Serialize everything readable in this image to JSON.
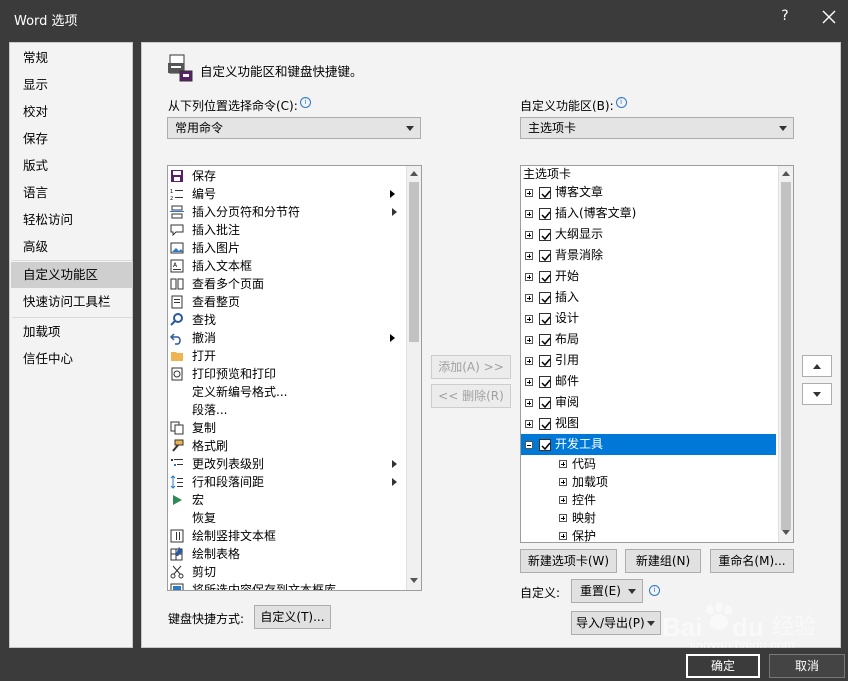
{
  "window": {
    "title": "Word 选项",
    "help": "?"
  },
  "nav": {
    "items": [
      "常规",
      "显示",
      "校对",
      "保存",
      "版式",
      "语言",
      "轻松访问",
      "高级",
      "自定义功能区",
      "快速访问工具栏",
      "加载项",
      "信任中心"
    ],
    "selected": "自定义功能区"
  },
  "main": {
    "heading": "自定义功能区和键盘快捷键。",
    "choose_label": "从下列位置选择命令(C):",
    "choose_value": "常用命令",
    "customize_label": "自定义功能区(B):",
    "customize_value": "主选项卡",
    "commands": [
      "保存",
      "编号",
      "插入分页符和分节符",
      "插入批注",
      "插入图片",
      "插入文本框",
      "查看多个页面",
      "查看整页",
      "查找",
      "撤消",
      "打开",
      "打印预览和打印",
      "定义新编号格式...",
      "段落...",
      "复制",
      "格式刷",
      "更改列表级别",
      "行和段落间距",
      "宏",
      "恢复",
      "绘制竖排文本框",
      "绘制表格",
      "剪切",
      "将所选内容保存到文本框库"
    ],
    "add_button": "添加(A) >>",
    "remove_button": "<< 删除(R)",
    "tree_header": "主选项卡",
    "tabs": [
      "博客文章",
      "插入(博客文章)",
      "大纲显示",
      "背景消除",
      "开始",
      "插入",
      "设计",
      "布局",
      "引用",
      "邮件",
      "审阅",
      "视图",
      "开发工具"
    ],
    "selected_tab": "开发工具",
    "groups": [
      "代码",
      "加载项",
      "控件",
      "映射",
      "保护"
    ],
    "new_tab_button": "新建选项卡(W)",
    "new_group_button": "新建组(N)",
    "rename_button": "重命名(M)...",
    "customizations_label": "自定义:",
    "reset_button": "重置(E)",
    "import_export_button": "导入/导出(P)",
    "keyboard_label": "键盘快捷方式:",
    "keyboard_button": "自定义(T)..."
  },
  "footer": {
    "ok": "确定",
    "cancel": "取消"
  },
  "watermark": {
    "text": "Bai du 经验",
    "url": "jingyan.baidu.com"
  },
  "colors": {
    "selection": "#0078d7",
    "chrome": "#3b3b3b",
    "panel": "#f3f3f3"
  }
}
